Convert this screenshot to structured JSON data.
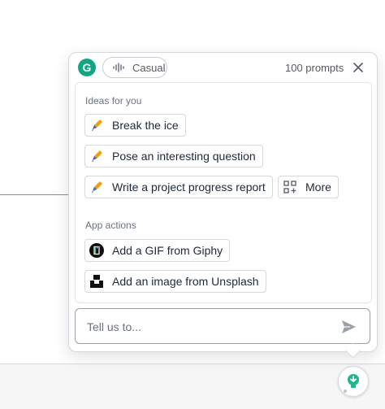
{
  "header": {
    "tone_label": "Casual",
    "prompts_label": "100 prompts",
    "logo_letter": "G"
  },
  "ideas": {
    "section_label": "Ideas for you",
    "items": [
      {
        "label": "Break the ice",
        "icon": "pencil-icon"
      },
      {
        "label": "Pose an interesting question",
        "icon": "pencil-icon"
      },
      {
        "label": "Write a project progress report",
        "icon": "pencil-icon"
      }
    ],
    "more_label": "More"
  },
  "app_actions": {
    "section_label": "App actions",
    "items": [
      {
        "label": "Add a GIF from Giphy",
        "icon": "giphy-icon"
      },
      {
        "label": "Add an image from Unsplash",
        "icon": "unsplash-icon"
      }
    ]
  },
  "composer": {
    "placeholder": "Tell us to..."
  },
  "colors": {
    "brand": "#11a683",
    "border": "#d6d8dc"
  }
}
